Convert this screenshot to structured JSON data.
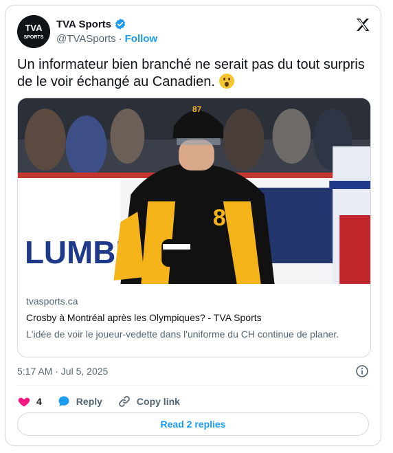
{
  "author": {
    "name": "TVA Sports",
    "handle": "@TVASports",
    "follow_label": "Follow",
    "avatar_text_top": "TVA",
    "avatar_text_bottom": "SPORTS"
  },
  "tweet": {
    "text": "Un informateur bien branché ne serait pas du tout surpris de le voir échangé au Canadien.",
    "emoji": "😮"
  },
  "link_card": {
    "domain": "tvasports.ca",
    "title": "Crosby à Montréal après les Olympiques? - TVA Sports",
    "description": "L'idée de voir le joueur-vedette dans l'uniforme du CH continue de planer.",
    "photo_jersey_number": "87",
    "photo_board_text": "LUMBER"
  },
  "meta": {
    "timestamp": "5:17 AM · Jul 5, 2025"
  },
  "actions": {
    "like_count": "4",
    "reply_label": "Reply",
    "copy_label": "Copy link",
    "read_replies_label": "Read 2 replies"
  },
  "colors": {
    "accent": "#1d9bf0",
    "like": "#f91880",
    "muted": "#536471"
  },
  "icons": [
    "verified-badge-icon",
    "x-logo-icon",
    "info-icon",
    "heart-icon",
    "reply-bubble-icon",
    "link-icon"
  ]
}
